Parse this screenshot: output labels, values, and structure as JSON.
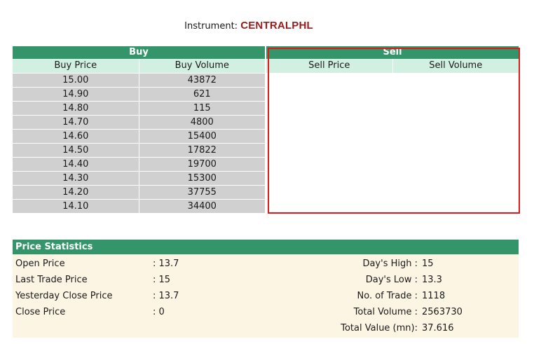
{
  "instrument": {
    "label": "Instrument:",
    "code": "CENTRALPHL"
  },
  "buy": {
    "title": "Buy",
    "col_price": "Buy Price",
    "col_volume": "Buy Volume",
    "rows": [
      {
        "price": "15.00",
        "volume": "43872"
      },
      {
        "price": "14.90",
        "volume": "621"
      },
      {
        "price": "14.80",
        "volume": "115"
      },
      {
        "price": "14.70",
        "volume": "4800"
      },
      {
        "price": "14.60",
        "volume": "15400"
      },
      {
        "price": "14.50",
        "volume": "17822"
      },
      {
        "price": "14.40",
        "volume": "19700"
      },
      {
        "price": "14.30",
        "volume": "15300"
      },
      {
        "price": "14.20",
        "volume": "37755"
      },
      {
        "price": "14.10",
        "volume": "34400"
      }
    ]
  },
  "sell": {
    "title": "Sell",
    "col_price": "Sell Price",
    "col_volume": "Sell Volume",
    "rows": []
  },
  "stats": {
    "title": "Price Statistics",
    "left": [
      {
        "label": "Open Price",
        "value": ": 13.7"
      },
      {
        "label": "Last Trade Price",
        "value": ": 15"
      },
      {
        "label": "Yesterday Close Price",
        "value": ": 13.7"
      },
      {
        "label": "Close Price",
        "value": ": 0"
      }
    ],
    "right": [
      {
        "label": "Day's High :",
        "value": "15"
      },
      {
        "label": "Day's Low :",
        "value": "13.3"
      },
      {
        "label": "No. of Trade :",
        "value": "1118"
      },
      {
        "label": "Total Volume :",
        "value": "2563730"
      },
      {
        "label": "Total Value (mn):",
        "value": "37.616"
      }
    ]
  },
  "colors": {
    "header_green": "#35956a",
    "subheader_green": "#d2f0e1",
    "row_gray": "#d0d0d0",
    "instrument_red": "#9a1b1b",
    "stats_bg": "#fdf5e4",
    "highlight_red": "#e01818"
  }
}
